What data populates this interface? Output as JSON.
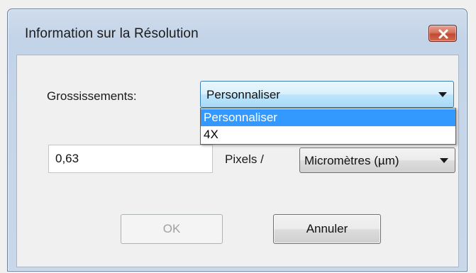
{
  "window": {
    "title": "Information sur la Résolution"
  },
  "magnification": {
    "label": "Grossissements:",
    "selected": "Personnaliser",
    "options": [
      "Personnaliser",
      "4X"
    ],
    "highlighted_option": "Personnaliser"
  },
  "resolution": {
    "value": "0,63",
    "pixels_label": "Pixels /",
    "unit_selected": "Micromètres (µm)"
  },
  "buttons": {
    "ok_label": "OK",
    "ok_enabled": false,
    "cancel_label": "Annuler"
  },
  "colors": {
    "selection_highlight": "#3399ff",
    "close_button": "#c74b33",
    "title_bar": "#c4d4e8"
  },
  "icons": {
    "close": "close-icon",
    "dropdown_arrow": "chevron-down-icon"
  }
}
